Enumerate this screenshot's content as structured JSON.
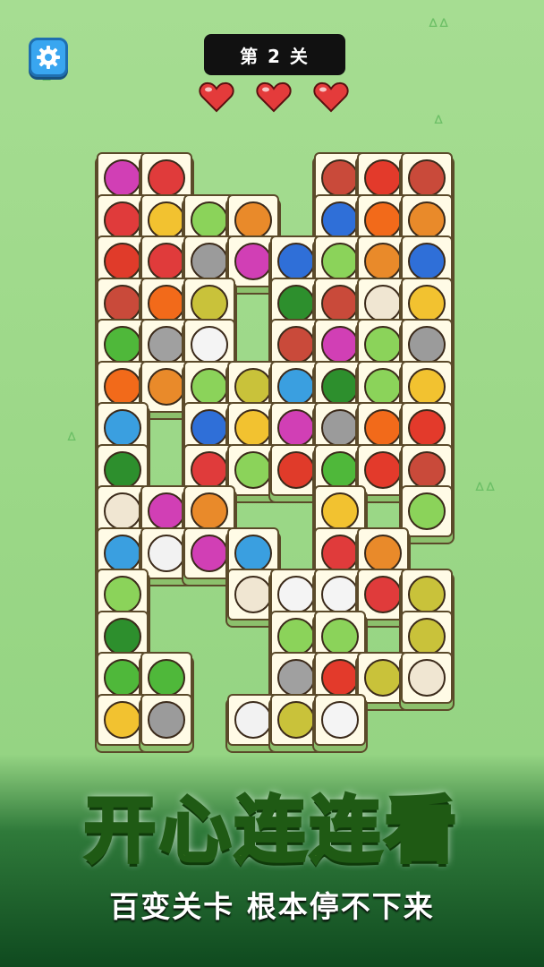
{
  "level_label": "第 2 关",
  "lives": {
    "current": 3,
    "max": 3,
    "color": "#e43b3b"
  },
  "banner": {
    "title": "开心连连看",
    "subtitle": "百变关卡 根本停不下来"
  },
  "tile_icons": {
    "yarn": "#d13fb5",
    "bucket": "#e03b3b",
    "steak": "#c94a3a",
    "pepper": "#e33a2b",
    "scissors": "#e03b3b",
    "wheat": "#f2c230",
    "cabbage": "#8bd35a",
    "drumstick": "#e98a2a",
    "mitten": "#2f6fd8",
    "tomato": "#e03b2a",
    "fork": "#9b9b9b",
    "fire": "#f26a1a",
    "lotus": "#c9c23a",
    "broccoli": "#2d8f2d",
    "mushroom": "#f0e6d2",
    "peapod": "#4fb83a",
    "cutlery": "#a0a0a0",
    "coconut": "#f4f4f4",
    "cart": "#3a9fe0",
    "bottle": "#f2f2f2"
  },
  "tiles": [
    {
      "c": 0,
      "r": 0,
      "icon": "yarn"
    },
    {
      "c": 1,
      "r": 0,
      "icon": "bucket"
    },
    {
      "c": 5,
      "r": 0,
      "icon": "steak"
    },
    {
      "c": 6,
      "r": 0,
      "icon": "pepper"
    },
    {
      "c": 7,
      "r": 0,
      "icon": "steak"
    },
    {
      "c": 0,
      "r": 1,
      "icon": "scissors"
    },
    {
      "c": 1,
      "r": 1,
      "icon": "wheat"
    },
    {
      "c": 2,
      "r": 1,
      "icon": "cabbage"
    },
    {
      "c": 3,
      "r": 1,
      "icon": "drumstick"
    },
    {
      "c": 5,
      "r": 1,
      "icon": "mitten"
    },
    {
      "c": 6,
      "r": 1,
      "icon": "fire"
    },
    {
      "c": 7,
      "r": 1,
      "icon": "drumstick"
    },
    {
      "c": 0,
      "r": 2,
      "icon": "tomato"
    },
    {
      "c": 1,
      "r": 2,
      "icon": "bucket"
    },
    {
      "c": 2,
      "r": 2,
      "icon": "fork"
    },
    {
      "c": 3,
      "r": 2,
      "icon": "yarn"
    },
    {
      "c": 4,
      "r": 2,
      "icon": "mitten"
    },
    {
      "c": 5,
      "r": 2,
      "icon": "cabbage"
    },
    {
      "c": 6,
      "r": 2,
      "icon": "drumstick"
    },
    {
      "c": 7,
      "r": 2,
      "icon": "mitten"
    },
    {
      "c": 0,
      "r": 3,
      "icon": "steak"
    },
    {
      "c": 1,
      "r": 3,
      "icon": "fire"
    },
    {
      "c": 2,
      "r": 3,
      "icon": "lotus"
    },
    {
      "c": 4,
      "r": 3,
      "icon": "broccoli"
    },
    {
      "c": 5,
      "r": 3,
      "icon": "steak"
    },
    {
      "c": 6,
      "r": 3,
      "icon": "mushroom"
    },
    {
      "c": 7,
      "r": 3,
      "icon": "wheat"
    },
    {
      "c": 0,
      "r": 4,
      "icon": "peapod"
    },
    {
      "c": 1,
      "r": 4,
      "icon": "cutlery"
    },
    {
      "c": 2,
      "r": 4,
      "icon": "coconut"
    },
    {
      "c": 4,
      "r": 4,
      "icon": "steak"
    },
    {
      "c": 5,
      "r": 4,
      "icon": "yarn"
    },
    {
      "c": 6,
      "r": 4,
      "icon": "cabbage"
    },
    {
      "c": 7,
      "r": 4,
      "icon": "fork"
    },
    {
      "c": 0,
      "r": 5,
      "icon": "fire"
    },
    {
      "c": 1,
      "r": 5,
      "icon": "drumstick"
    },
    {
      "c": 2,
      "r": 5,
      "icon": "cabbage"
    },
    {
      "c": 3,
      "r": 5,
      "icon": "lotus"
    },
    {
      "c": 4,
      "r": 5,
      "icon": "cart"
    },
    {
      "c": 5,
      "r": 5,
      "icon": "broccoli"
    },
    {
      "c": 6,
      "r": 5,
      "icon": "cabbage"
    },
    {
      "c": 7,
      "r": 5,
      "icon": "wheat"
    },
    {
      "c": 0,
      "r": 6,
      "icon": "cart"
    },
    {
      "c": 2,
      "r": 6,
      "icon": "mitten"
    },
    {
      "c": 3,
      "r": 6,
      "icon": "wheat"
    },
    {
      "c": 4,
      "r": 6,
      "icon": "yarn"
    },
    {
      "c": 5,
      "r": 6,
      "icon": "fork"
    },
    {
      "c": 6,
      "r": 6,
      "icon": "fire"
    },
    {
      "c": 7,
      "r": 6,
      "icon": "pepper"
    },
    {
      "c": 0,
      "r": 7,
      "icon": "broccoli"
    },
    {
      "c": 2,
      "r": 7,
      "icon": "scissors"
    },
    {
      "c": 3,
      "r": 7,
      "icon": "cabbage"
    },
    {
      "c": 4,
      "r": 7,
      "icon": "tomato"
    },
    {
      "c": 5,
      "r": 7,
      "icon": "peapod"
    },
    {
      "c": 6,
      "r": 7,
      "icon": "pepper"
    },
    {
      "c": 7,
      "r": 7,
      "icon": "steak"
    },
    {
      "c": 0,
      "r": 8,
      "icon": "mushroom"
    },
    {
      "c": 1,
      "r": 8,
      "icon": "yarn"
    },
    {
      "c": 2,
      "r": 8,
      "icon": "drumstick"
    },
    {
      "c": 5,
      "r": 8,
      "icon": "wheat"
    },
    {
      "c": 7,
      "r": 8,
      "icon": "cabbage"
    },
    {
      "c": 0,
      "r": 9,
      "icon": "cart"
    },
    {
      "c": 1,
      "r": 9,
      "icon": "bottle"
    },
    {
      "c": 2,
      "r": 9,
      "icon": "yarn"
    },
    {
      "c": 3,
      "r": 9,
      "icon": "cart"
    },
    {
      "c": 5,
      "r": 9,
      "icon": "bucket"
    },
    {
      "c": 6,
      "r": 9,
      "icon": "drumstick"
    },
    {
      "c": 0,
      "r": 10,
      "icon": "cabbage"
    },
    {
      "c": 3,
      "r": 10,
      "icon": "mushroom"
    },
    {
      "c": 4,
      "r": 10,
      "icon": "coconut"
    },
    {
      "c": 5,
      "r": 10,
      "icon": "coconut"
    },
    {
      "c": 6,
      "r": 10,
      "icon": "bucket"
    },
    {
      "c": 7,
      "r": 10,
      "icon": "lotus"
    },
    {
      "c": 0,
      "r": 11,
      "icon": "broccoli"
    },
    {
      "c": 4,
      "r": 11,
      "icon": "cabbage"
    },
    {
      "c": 5,
      "r": 11,
      "icon": "cabbage"
    },
    {
      "c": 7,
      "r": 11,
      "icon": "lotus"
    },
    {
      "c": 0,
      "r": 12,
      "icon": "peapod"
    },
    {
      "c": 1,
      "r": 12,
      "icon": "peapod"
    },
    {
      "c": 4,
      "r": 12,
      "icon": "cutlery"
    },
    {
      "c": 5,
      "r": 12,
      "icon": "pepper"
    },
    {
      "c": 6,
      "r": 12,
      "icon": "lotus"
    },
    {
      "c": 7,
      "r": 12,
      "icon": "mushroom"
    },
    {
      "c": 0,
      "r": 13,
      "icon": "wheat"
    },
    {
      "c": 1,
      "r": 13,
      "icon": "fork"
    },
    {
      "c": 3,
      "r": 13,
      "icon": "bottle"
    },
    {
      "c": 4,
      "r": 13,
      "icon": "lotus"
    },
    {
      "c": 5,
      "r": 13,
      "icon": "coconut"
    }
  ]
}
